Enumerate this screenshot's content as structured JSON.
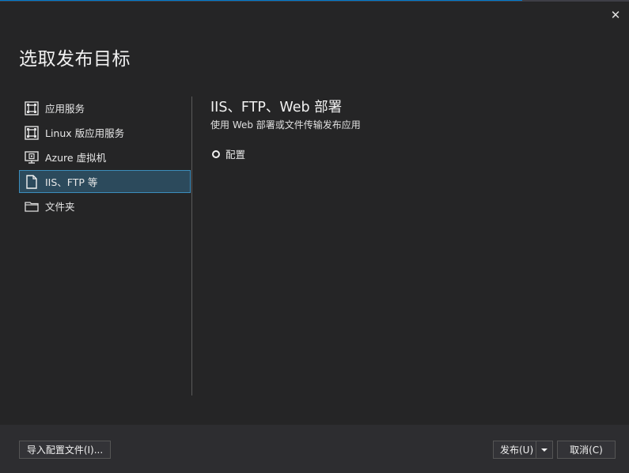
{
  "window": {
    "title": "选取发布目标",
    "close_label": "✕"
  },
  "targets": [
    {
      "label": "应用服务",
      "icon": "app-service-icon"
    },
    {
      "label": "Linux 版应用服务",
      "icon": "app-service-linux-icon"
    },
    {
      "label": "Azure 虚拟机",
      "icon": "virtual-machine-icon"
    },
    {
      "label": "IIS、FTP 等",
      "icon": "document-icon",
      "selected": true
    },
    {
      "label": "文件夹",
      "icon": "folder-icon"
    }
  ],
  "detail": {
    "title": "IIS、FTP、Web 部署",
    "description": "使用 Web 部署或文件传输发布应用",
    "radio_label": "配置"
  },
  "footer": {
    "import_label": "导入配置文件(I)...",
    "publish_label": "发布(U)",
    "cancel_label": "取消(C)"
  },
  "colors": {
    "background": "#252526",
    "footer": "#2d2d30",
    "selection": "#2c4a5c",
    "selection_border": "#3c8dbc",
    "accent": "#007acc"
  }
}
